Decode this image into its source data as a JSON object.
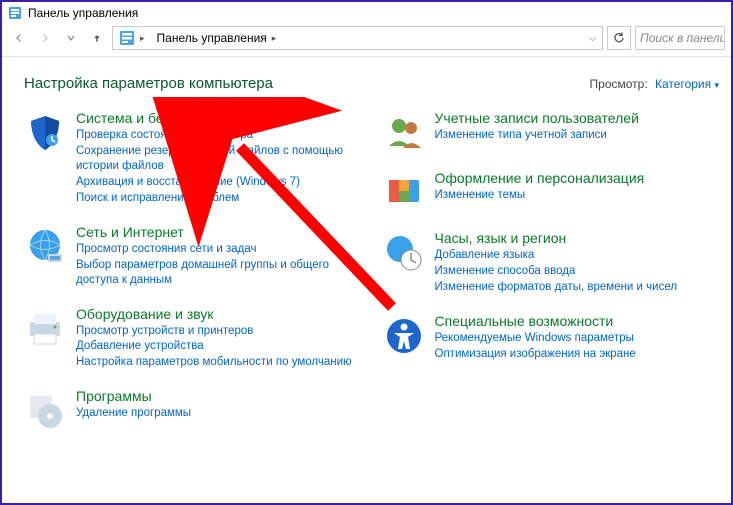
{
  "window": {
    "title": "Панель управления"
  },
  "nav": {
    "address_segment": "Панель управления",
    "search_placeholder": "Поиск в панели"
  },
  "header": {
    "title": "Настройка параметров компьютера",
    "view_label": "Просмотр:",
    "view_value": "Категория"
  },
  "categories": {
    "system": {
      "title": "Система и безопасность",
      "links": [
        "Проверка состояния компьютера",
        "Сохранение резервных копий файлов с помощью истории файлов",
        "Архивация и восстановление (Windows 7)",
        "Поиск и исправление проблем"
      ]
    },
    "network": {
      "title": "Сеть и Интернет",
      "links": [
        "Просмотр состояния сети и задач",
        "Выбор параметров домашней группы и общего доступа к данным"
      ]
    },
    "hardware": {
      "title": "Оборудование и звук",
      "links": [
        "Просмотр устройств и принтеров",
        "Добавление устройства",
        "Настройка параметров мобильности по умолчанию"
      ]
    },
    "programs": {
      "title": "Программы",
      "links": [
        "Удаление программы"
      ]
    },
    "users": {
      "title": "Учетные записи пользователей",
      "links": [
        "Изменение типа учетной записи"
      ]
    },
    "appearance": {
      "title": "Оформление и персонализация",
      "links": [
        "Изменение темы"
      ]
    },
    "clock": {
      "title": "Часы, язык и регион",
      "links": [
        "Добавление языка",
        "Изменение способа ввода",
        "Изменение форматов даты, времени и чисел"
      ]
    },
    "ease": {
      "title": "Специальные возможности",
      "links": [
        "Рекомендуемые Windows параметры",
        "Оптимизация изображения на экране"
      ]
    }
  }
}
